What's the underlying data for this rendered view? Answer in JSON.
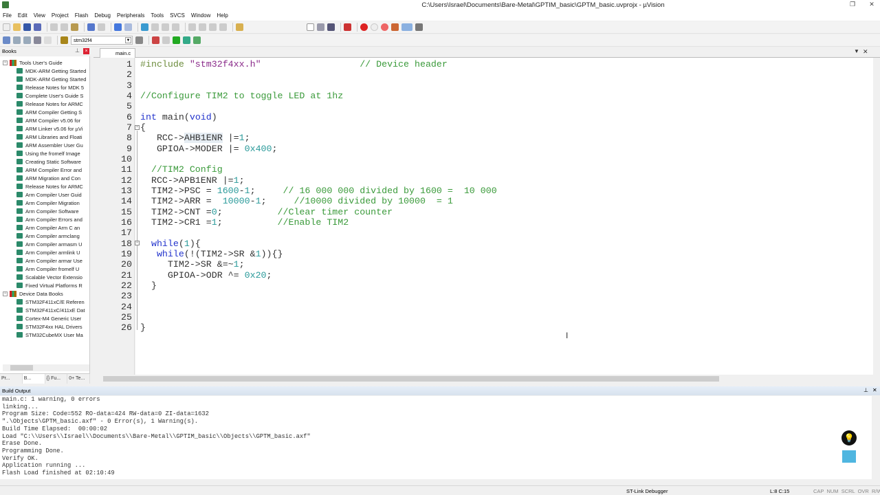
{
  "window": {
    "title": "C:\\Users\\Israel\\Documents\\Bare-Metal\\GPTIM_basic\\GPTM_basic.uvprojx - µVision"
  },
  "menu": [
    "File",
    "Edit",
    "View",
    "Project",
    "Flash",
    "Debug",
    "Peripherals",
    "Tools",
    "SVCS",
    "Window",
    "Help"
  ],
  "toolbar2": {
    "target": "stm32f4"
  },
  "books": {
    "header": "Books",
    "groups": [
      {
        "label": "Tools User's Guide",
        "items": [
          "MDK-ARM Getting Started",
          "MDK-ARM Getting Started",
          "Release Notes for MDK 5",
          "Complete User's Guide S",
          "Release Notes for ARMC",
          "ARM Compiler Getting S",
          "ARM Compiler v5.06 for",
          "ARM Linker v5.06 for µVi",
          "ARM Libraries and Floati",
          "ARM Assembler User Gu",
          "Using the fromelf Image",
          "Creating Static Software",
          "ARM Compiler Error and",
          "ARM Migration and Con",
          "Release Notes for ARMC",
          "Arm Compiler User Guid",
          "Arm Compiler Migration",
          "Arm Compiler Software",
          "Arm Compiler Errors and",
          "Arm Compiler Arm C an",
          "Arm Compiler armclang",
          "Arm Compiler armasm U",
          "Arm Compiler armlink U",
          "Arm Compiler armar Use",
          "Arm Compiler fromelf U",
          "Scalable Vector Extensio",
          "Fixed Virtual Platforms R"
        ]
      },
      {
        "label": "Device Data Books",
        "items": [
          "STM32F411xC/E Referen",
          "STM32F411xC/411xE Dat",
          "Cortex-M4 Generic User",
          "STM32F4xx HAL Drivers",
          "STM32CubeMX User Ma"
        ]
      }
    ]
  },
  "panel_tabs": [
    "Pr...",
    "B...",
    "{} Fu...",
    "0+ Te..."
  ],
  "editor": {
    "tab": "main.c",
    "lines": [
      [
        [
          "#include ",
          "p"
        ],
        [
          "\"stm32f4xx.h\"",
          "s"
        ],
        [
          "                  ",
          ""
        ],
        [
          "// Device header",
          "c"
        ]
      ],
      [],
      [],
      [
        [
          "//Configure TIM2 to toggle LED at 1hz",
          "c"
        ]
      ],
      [],
      [
        [
          "int",
          "k"
        ],
        [
          " main(",
          ""
        ],
        [
          "void",
          "k"
        ],
        [
          ")",
          ""
        ]
      ],
      [
        [
          "{",
          ""
        ]
      ],
      [
        [
          "   RCC->",
          ""
        ],
        [
          "AHB1ENR",
          "h"
        ],
        [
          " |=",
          ""
        ],
        [
          "1",
          "n"
        ],
        [
          ";",
          ""
        ]
      ],
      [
        [
          "   GPIOA->MODER |= ",
          ""
        ],
        [
          "0x400",
          "n"
        ],
        [
          ";",
          ""
        ]
      ],
      [],
      [
        [
          "  ",
          ""
        ],
        [
          "//TIM2 Config",
          "c"
        ]
      ],
      [
        [
          "  RCC->APB1ENR |=",
          ""
        ],
        [
          "1",
          "n"
        ],
        [
          ";",
          ""
        ]
      ],
      [
        [
          "  TIM2->PSC = ",
          ""
        ],
        [
          "1600",
          "n"
        ],
        [
          "-",
          ""
        ],
        [
          "1",
          "n"
        ],
        [
          ";     ",
          ""
        ],
        [
          "// 16 000 000 divided by 1600 =  10 000",
          "c"
        ]
      ],
      [
        [
          "  TIM2->ARR =  ",
          ""
        ],
        [
          "10000",
          "n"
        ],
        [
          "-",
          ""
        ],
        [
          "1",
          "n"
        ],
        [
          ";     ",
          ""
        ],
        [
          "//10000 divided by 10000  = 1",
          "c"
        ]
      ],
      [
        [
          "  TIM2->CNT =",
          ""
        ],
        [
          "0",
          "n"
        ],
        [
          ";          ",
          ""
        ],
        [
          "//Clear timer counter",
          "c"
        ]
      ],
      [
        [
          "  TIM2->CR1 =",
          ""
        ],
        [
          "1",
          "n"
        ],
        [
          ";          ",
          ""
        ],
        [
          "//Enable TIM2",
          "c"
        ]
      ],
      [],
      [
        [
          "  ",
          ""
        ],
        [
          "while",
          "k"
        ],
        [
          "(",
          ""
        ],
        [
          "1",
          "n"
        ],
        [
          "){",
          ""
        ]
      ],
      [
        [
          "   ",
          ""
        ],
        [
          "while",
          "k"
        ],
        [
          "(!(TIM2->SR &",
          ""
        ],
        [
          "1",
          "n"
        ],
        [
          ")){}",
          ""
        ]
      ],
      [
        [
          "     TIM2->SR &=~",
          ""
        ],
        [
          "1",
          "n"
        ],
        [
          ";",
          ""
        ]
      ],
      [
        [
          "     GPIOA->ODR ^= ",
          ""
        ],
        [
          "0x20",
          "n"
        ],
        [
          ";",
          ""
        ]
      ],
      [
        [
          "  }",
          ""
        ]
      ],
      [],
      [],
      [],
      [
        [
          "}",
          ""
        ]
      ]
    ]
  },
  "build_output": {
    "header": "Build Output",
    "lines": [
      "main.c: 1 warning, 0 errors",
      "linking...",
      "Program Size: Code=552 RO-data=424 RW-data=0 ZI-data=1632",
      "\".\\Objects\\GPTM_basic.axf\" - 0 Error(s), 1 Warning(s).",
      "Build Time Elapsed:  00:00:02",
      "Load \"C:\\\\Users\\\\Israel\\\\Documents\\\\Bare-Metal\\\\GPTIM_basic\\\\Objects\\\\GPTM_basic.axf\"",
      "Erase Done.",
      "Programming Done.",
      "Verify OK.",
      "Application running ...",
      "Flash Load finished at 02:10:49"
    ]
  },
  "status": {
    "debugger": "ST-Link Debugger",
    "position": "L:8 C:15",
    "indicators": "CAP  NUM  SCRL  OVR  R/W"
  }
}
